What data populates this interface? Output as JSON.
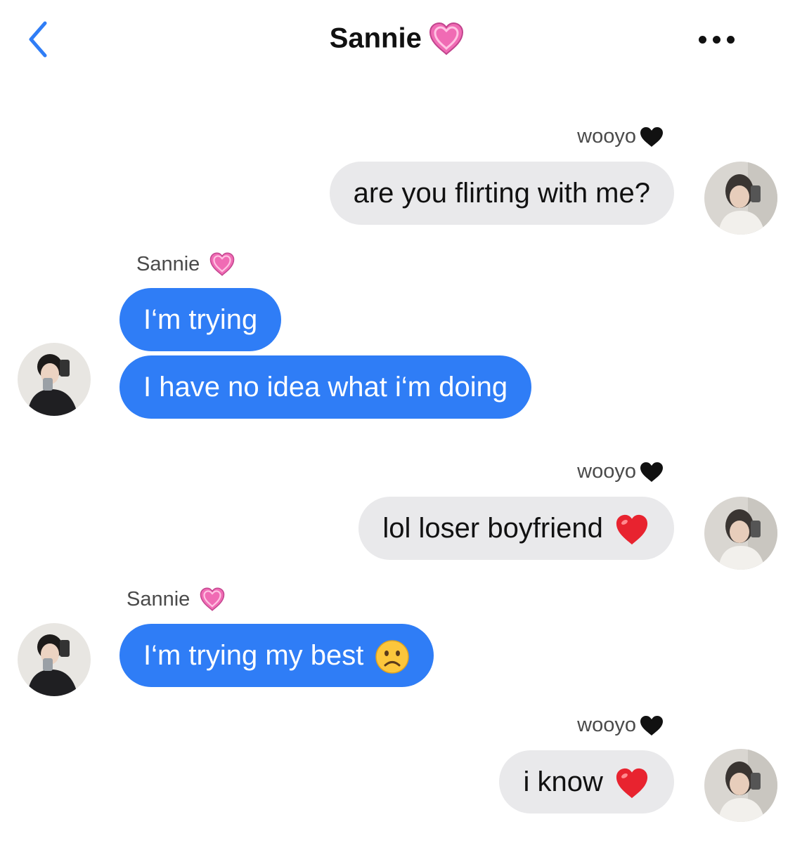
{
  "header": {
    "title": "Sannie",
    "title_emoji": "heart-pink-icon",
    "back_icon": "chevron-left-icon",
    "more_icon": "ellipsis-icon"
  },
  "messages": [
    {
      "sender": "wooyo",
      "sender_emoji": "heart-black-icon",
      "side": "right",
      "text": "are you flirting with me?"
    },
    {
      "sender": "Sannie",
      "sender_emoji": "heart-pink-icon",
      "side": "left",
      "text": "I‘m trying"
    },
    {
      "sender": "Sannie",
      "side": "left",
      "text": "I have no idea what i‘m doing"
    },
    {
      "sender": "wooyo",
      "sender_emoji": "heart-black-icon",
      "side": "right",
      "text": "lol loser boyfriend",
      "text_emoji": "heart-red-icon"
    },
    {
      "sender": "Sannie",
      "sender_emoji": "heart-pink-icon",
      "side": "left",
      "text": "I‘m trying my best",
      "text_emoji": "frowning-face-icon"
    },
    {
      "sender": "wooyo",
      "sender_emoji": "heart-black-icon",
      "side": "right",
      "text": "i know",
      "text_emoji": "heart-red-icon"
    }
  ],
  "colors": {
    "accent": "#2f7df6",
    "incoming_bubble": "#e9e9eb",
    "outgoing_bubble": "#2f7df6",
    "pink_heart": "#f06bb4",
    "red_heart": "#e8232f"
  }
}
